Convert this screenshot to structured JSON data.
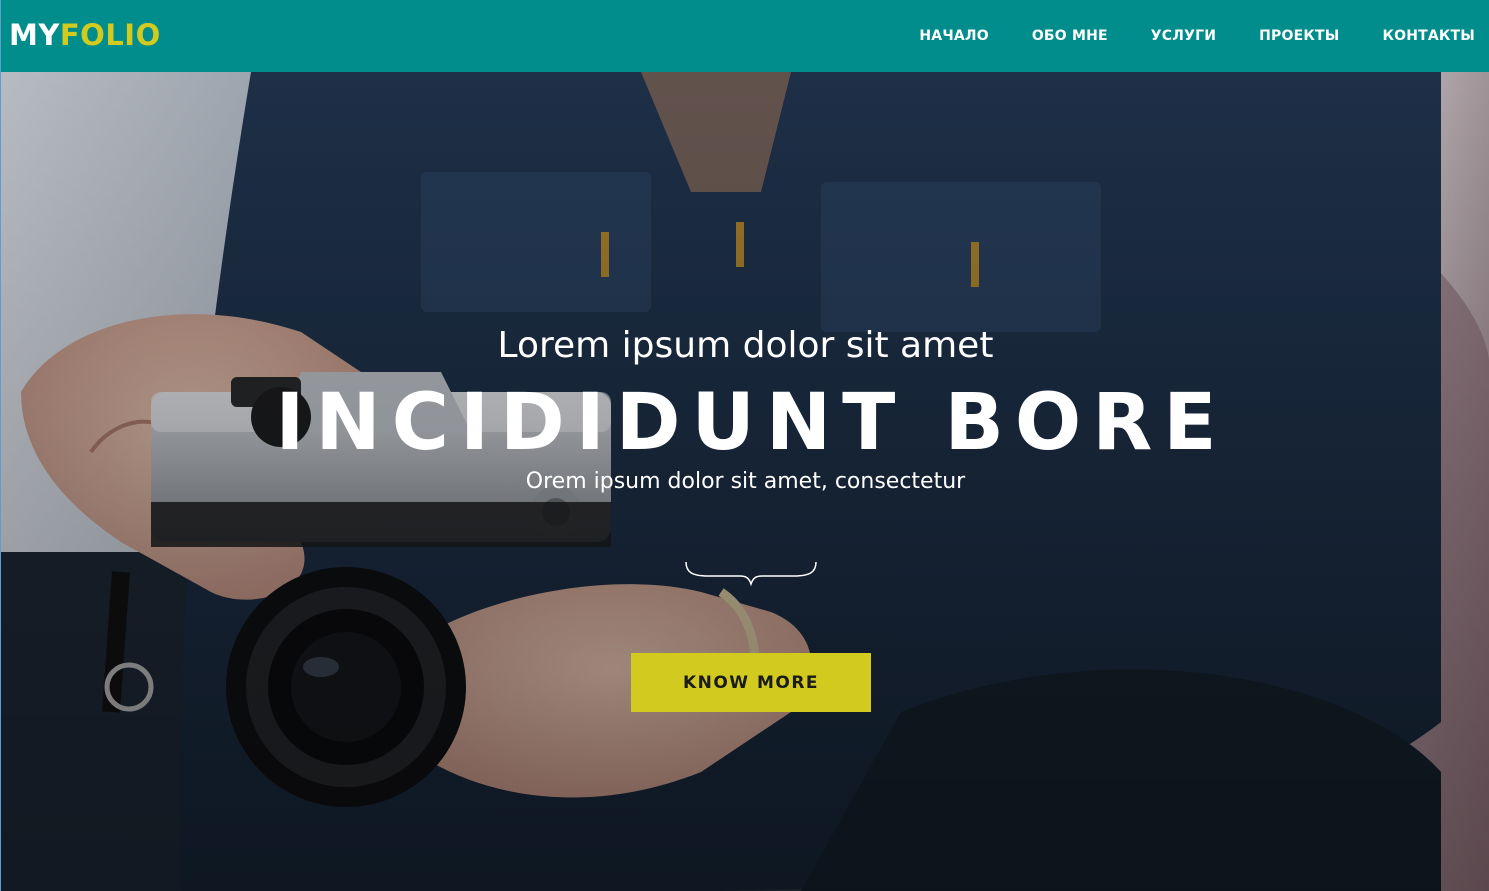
{
  "header": {
    "logo_primary": "MY",
    "logo_secondary": "FOLIO",
    "nav": [
      {
        "label": "НАЧАЛО"
      },
      {
        "label": "ОБО МНЕ"
      },
      {
        "label": "УСЛУГИ"
      },
      {
        "label": "ПРОЕКТЫ"
      },
      {
        "label": "КОНТАКТЫ"
      }
    ]
  },
  "hero": {
    "subtitle": "Lorem ipsum dolor sit amet",
    "headline": "INCIDIDUNT BORE",
    "tagline": "Orem ipsum dolor sit amet, consectetur",
    "cta_label": "KNOW MORE",
    "divider_icon": "curly-brace-divider-icon",
    "background_image": "photographer-holding-camera"
  },
  "colors": {
    "navbar": "#018d8c",
    "accent": "#d2ca1e",
    "text_light": "#ffffff",
    "button_text": "#1b1b1b"
  }
}
